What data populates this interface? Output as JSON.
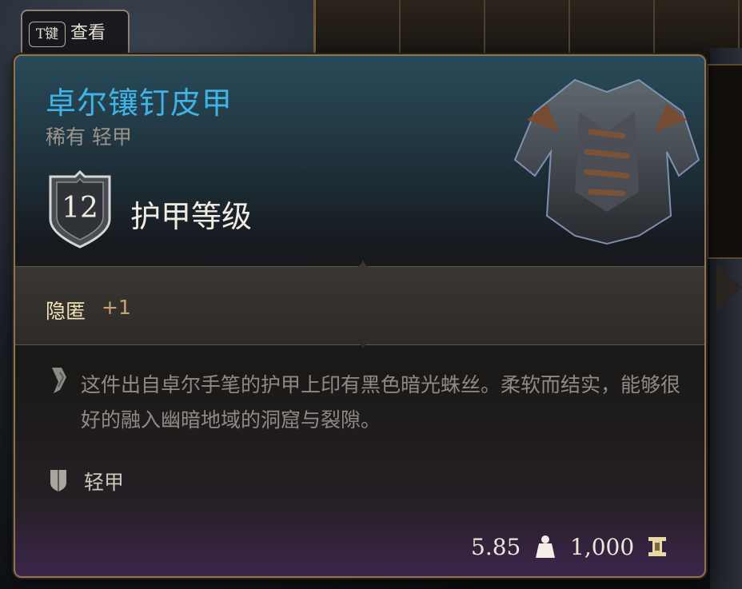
{
  "hint": {
    "key": "T键",
    "label": "查看"
  },
  "item": {
    "name": "卓尔镶钉皮甲",
    "subtitle": "稀有 轻甲",
    "name_color": "#3fb3e6",
    "armor_class": "12",
    "armor_class_label": "护甲等级",
    "skill": "隐匿",
    "skill_bonus": "+1",
    "description": "这件出自卓尔手笔的护甲上印有黑色暗光蛛丝。柔软而结实，能够很好的融入幽暗地域的洞窟与裂隙。",
    "type": "轻甲",
    "weight": "5.85",
    "price": "1,000"
  },
  "icons": {
    "armor_class": "shield-icon",
    "description": "lore-quill-icon",
    "type": "light-armor-icon",
    "weight": "weight-icon",
    "price": "gold-coin-icon"
  }
}
